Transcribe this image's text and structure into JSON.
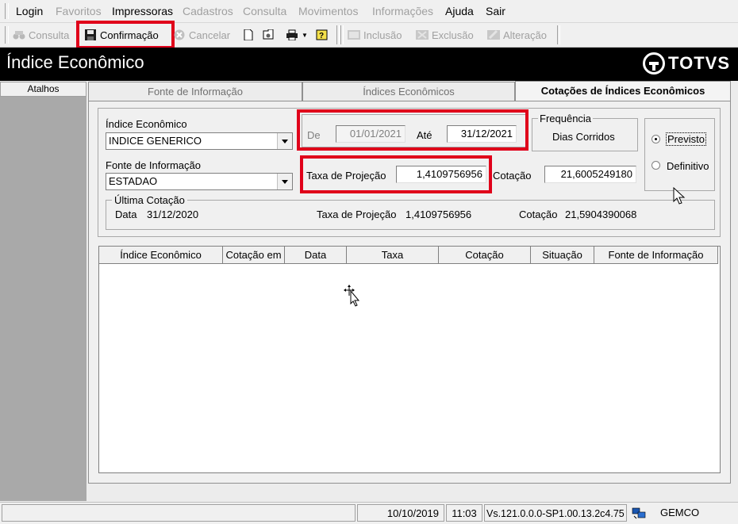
{
  "menu": {
    "items": [
      {
        "label": "Login",
        "enabled": true
      },
      {
        "label": "Favoritos",
        "enabled": false
      },
      {
        "label": "Impressoras",
        "enabled": true
      },
      {
        "label": "Cadastros",
        "enabled": false
      },
      {
        "label": "Consulta",
        "enabled": false
      },
      {
        "label": "Movimentos",
        "enabled": false
      },
      {
        "label": "Informações",
        "enabled": false
      },
      {
        "label": "Ajuda",
        "enabled": true
      },
      {
        "label": "Sair",
        "enabled": true
      }
    ]
  },
  "toolbar": {
    "consulta": "Consulta",
    "confirmacao": "Confirmação",
    "cancelar": "Cancelar",
    "inclusao": "Inclusão",
    "exclusao": "Exclusão",
    "alteracao": "Alteração"
  },
  "title": "Índice Econômico",
  "brand": "TOTVS",
  "sidebar": {
    "header": "Atalhos"
  },
  "tabs": [
    {
      "label": "Fonte de Informação",
      "active": false
    },
    {
      "label": "Índices Econômicos",
      "active": false
    },
    {
      "label": "Cotações de Índices Econômicos",
      "active": true
    }
  ],
  "form": {
    "indice_label": "Índice Econômico",
    "indice_value": "INDICE GENERICO",
    "fonte_label": "Fonte de Informação",
    "fonte_value": "ESTADAO",
    "de_label": "De",
    "de_value": "01/01/2021",
    "ate_label": "Até",
    "ate_value": "31/12/2021",
    "frequencia_label": "Frequência",
    "frequencia_value": "Dias Corridos",
    "taxa_label": "Taxa de Projeção",
    "taxa_value": "1,4109756956",
    "cotacao_label": "Cotação",
    "cotacao_value": "21,6005249180",
    "previsto_label": "Previsto",
    "definitivo_label": "Definitivo",
    "ultima": {
      "title": "Última Cotação",
      "data_label": "Data",
      "data_value": "31/12/2020",
      "taxa_label": "Taxa de Projeção",
      "taxa_value": "1,4109756956",
      "cotacao_label": "Cotação",
      "cotacao_value": "21,5904390068"
    }
  },
  "grid": {
    "columns": [
      "Índice Econômico",
      "Cotação em",
      "Data",
      "Taxa",
      "Cotação",
      "Situação",
      "Fonte de Informação"
    ]
  },
  "status": {
    "date": "10/10/2019",
    "time": "11:03",
    "version": "Vs.121.0.0.0-SP1.00.13.2c4.75",
    "company": "GEMCO"
  },
  "colors": {
    "highlight": "#e0001a",
    "title_bg": "#000000",
    "sidebar": "#a9a9a9"
  }
}
